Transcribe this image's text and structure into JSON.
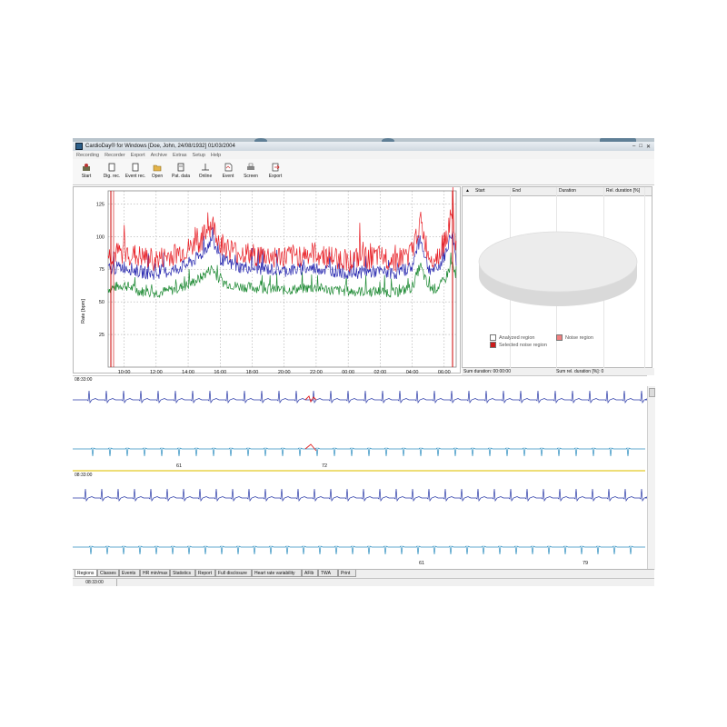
{
  "window": {
    "title": "CardioDay® for Windows [Doe, John, 24/08/1932] 01/03/2004",
    "controls": [
      "–",
      "□",
      "✕"
    ]
  },
  "menu": [
    "Recording",
    "Recorder",
    "Export",
    "Archive",
    "Extras",
    "Setup",
    "Help"
  ],
  "toolbar": [
    {
      "label": "Start",
      "icon": "start-icon"
    },
    {
      "label": "Dig. rec.",
      "icon": "document-icon"
    },
    {
      "label": "Event rec.",
      "icon": "document-icon"
    },
    {
      "label": "Open",
      "icon": "folder-icon"
    },
    {
      "label": "Pat. data",
      "icon": "patient-icon"
    },
    {
      "label": "Online",
      "icon": "online-icon"
    },
    {
      "label": "Event",
      "icon": "event-icon"
    },
    {
      "label": "Screen",
      "icon": "printer-icon"
    },
    {
      "label": "Export",
      "icon": "export-icon"
    }
  ],
  "trend": {
    "ylabel": "Rate [bpm]",
    "yticks": [
      "125",
      "100",
      "75",
      "50",
      "25"
    ],
    "xticks": [
      "10:00",
      "12:00",
      "14:00",
      "16:00",
      "18:00",
      "20:00",
      "22:00",
      "00:00",
      "02:00",
      "04:00",
      "06:00"
    ],
    "colors": {
      "max": "#e8232a",
      "mean": "#2a2ab0",
      "min": "#1e8a34",
      "marker": "#cc0000"
    }
  },
  "chart_data": {
    "type": "line",
    "ylabel": "Rate [bpm]",
    "ylim": [
      0,
      135
    ],
    "x_range": [
      "09:00",
      "06:45"
    ],
    "grid": true,
    "x": [
      "09:00",
      "10:00",
      "11:00",
      "12:00",
      "13:00",
      "14:00",
      "14:45",
      "15:30",
      "16:00",
      "17:00",
      "18:00",
      "19:00",
      "20:00",
      "21:00",
      "22:00",
      "23:00",
      "00:00",
      "01:00",
      "02:00",
      "03:00",
      "04:00",
      "04:30",
      "05:00",
      "05:30",
      "06:00",
      "06:30",
      "06:45"
    ],
    "series": [
      {
        "values": [
          85,
          88,
          84,
          82,
          86,
          90,
          96,
          110,
          95,
          88,
          86,
          85,
          84,
          86,
          87,
          84,
          82,
          83,
          84,
          82,
          88,
          112,
          86,
          84,
          95,
          118,
          92
        ]
      },
      {
        "values": [
          75,
          77,
          73,
          71,
          74,
          79,
          85,
          98,
          83,
          77,
          76,
          75,
          74,
          75,
          76,
          74,
          72,
          73,
          73,
          72,
          77,
          99,
          76,
          74,
          84,
          104,
          82
        ]
      },
      {
        "values": [
          60,
          63,
          58,
          57,
          59,
          63,
          68,
          76,
          66,
          62,
          61,
          60,
          59,
          60,
          61,
          59,
          58,
          58,
          58,
          57,
          61,
          78,
          61,
          60,
          66,
          80,
          66
        ]
      }
    ]
  },
  "regions_table": {
    "columns": [
      "Start",
      "End",
      "Duration",
      "Rel. duration [%]"
    ],
    "sort_indicator": "▲",
    "legend": [
      "Analyzed region",
      "Noise region",
      "Selected noise region"
    ],
    "legend_colors": [
      "#ffffff",
      "#f08080",
      "#cc1a1a"
    ],
    "sum_duration": "Sum duration: 00:00:00",
    "sum_rel_duration": "Sum rel. duration [%]: 0"
  },
  "ecg": {
    "strip1_time": "08:33:00",
    "strip2_time": "08:33:00",
    "strip1_hr": [
      "61",
      "72"
    ],
    "strip2_hr": [
      "61",
      "79"
    ]
  },
  "tabs": [
    "Regions",
    "Classes",
    "Events",
    "HR min/max",
    "Statistics",
    "Report",
    "Full disclosure",
    "Heart rate variability",
    "AFib",
    "TWA",
    "Print"
  ],
  "status": {
    "time": "08:33:00"
  }
}
